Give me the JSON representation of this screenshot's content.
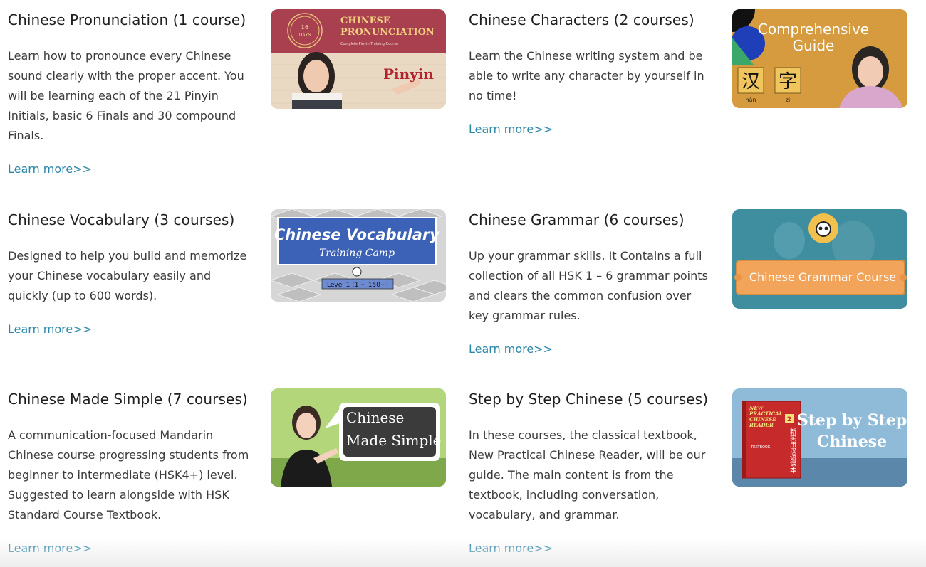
{
  "courses": [
    {
      "title": "Chinese Pronunciation (1 course)",
      "description": "Learn how to pronounce every Chinese sound clearly with the proper accent. You will be learning each of the 21 Pinyin Initials, basic 6 Finals and 30 compound Finals.",
      "link": "Learn more>>",
      "thumb": {
        "badge_line1": "16",
        "badge_line2": "DAYS",
        "title_line1": "CHINESE",
        "title_line2": "PRONUNCIATION",
        "subtitle": "Complete Pinyin Training Course",
        "word": "Pinyin"
      }
    },
    {
      "title": "Chinese Characters (2 courses)",
      "description": "Learn the Chinese writing system and be able to write any character by yourself in no time!",
      "link": "Learn more>>",
      "thumb": {
        "title_line1": "Comprehensive",
        "title_line2": "Guide",
        "char1": "汉",
        "char2": "字",
        "pinyin1": "hàn",
        "pinyin2": "zì"
      }
    },
    {
      "title": "Chinese Vocabulary (3 courses)",
      "description": "Designed to help you build and memorize your Chinese vocabulary easily and quickly (up to 600 words).",
      "link": "Learn more>>",
      "thumb": {
        "title": "Chinese Vocabulary",
        "subtitle": "Training Camp",
        "level": "Level 1  (1 ~ 150+)"
      }
    },
    {
      "title": "Chinese Grammar (6 courses)",
      "description": "Up your grammar skills. It Contains a full collection of all HSK 1 – 6 grammar points and clears the common confusion over key grammar rules.",
      "link": "Learn more>>",
      "thumb": {
        "banner": "Chinese Grammar Course"
      }
    },
    {
      "title": "Chinese Made Simple (7 courses)",
      "description": "A communication-focused Mandarin Chinese course progressing students from beginner to intermediate (HSK4+) level. Suggested to learn alongside with HSK Standard Course Textbook.",
      "link": "Learn more>>",
      "thumb": {
        "bubble_line1": "Chinese",
        "bubble_line2": "Made Simple"
      }
    },
    {
      "title": "Step by Step Chinese (5 courses)",
      "description": "In these courses, the classical textbook, New Practical Chinese Reader, will be our guide. The main content is from the textbook, including conversation, vocabulary, and grammar.",
      "link": "Learn more>>",
      "thumb": {
        "title_line1": "Step by Step",
        "title_line2": "Chinese",
        "book_line1": "NEW",
        "book_line2": "PRACTICAL",
        "book_line3": "CHINESE",
        "book_line4": "READER",
        "book_num": "2",
        "book_label": "TEXTBOOK",
        "book_cn": "新实用汉语课本"
      }
    }
  ],
  "colors": {
    "link": "#2b86a8",
    "heading": "#1f1f1f",
    "body": "#3a3a3a"
  }
}
